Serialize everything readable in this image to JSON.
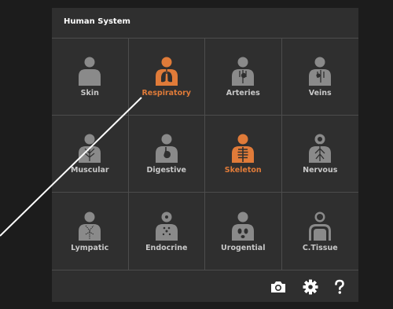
{
  "panel": {
    "title": "Human System"
  },
  "colors": {
    "active": "#e07b39",
    "inactive": "#8a8a8a",
    "label": "#c8c8c8"
  },
  "systems": [
    {
      "label": "Skin",
      "icon": "skin-icon",
      "active": false
    },
    {
      "label": "Respiratory",
      "icon": "lungs-icon",
      "active": true
    },
    {
      "label": "Arteries",
      "icon": "arteries-icon",
      "active": false
    },
    {
      "label": "Veins",
      "icon": "veins-icon",
      "active": false
    },
    {
      "label": "Muscular",
      "icon": "muscle-icon",
      "active": false
    },
    {
      "label": "Digestive",
      "icon": "stomach-icon",
      "active": false
    },
    {
      "label": "Skeleton",
      "icon": "ribcage-icon",
      "active": true
    },
    {
      "label": "Nervous",
      "icon": "nerve-icon",
      "active": false
    },
    {
      "label": "Lympatic",
      "icon": "lymph-icon",
      "active": false
    },
    {
      "label": "Endocrine",
      "icon": "gland-icon",
      "active": false
    },
    {
      "label": "Urogential",
      "icon": "kidney-icon",
      "active": false
    },
    {
      "label": "C.Tissue",
      "icon": "tissue-icon",
      "active": false
    }
  ],
  "footer": {
    "buttons": [
      "camera-icon",
      "gear-icon",
      "help-icon"
    ]
  }
}
